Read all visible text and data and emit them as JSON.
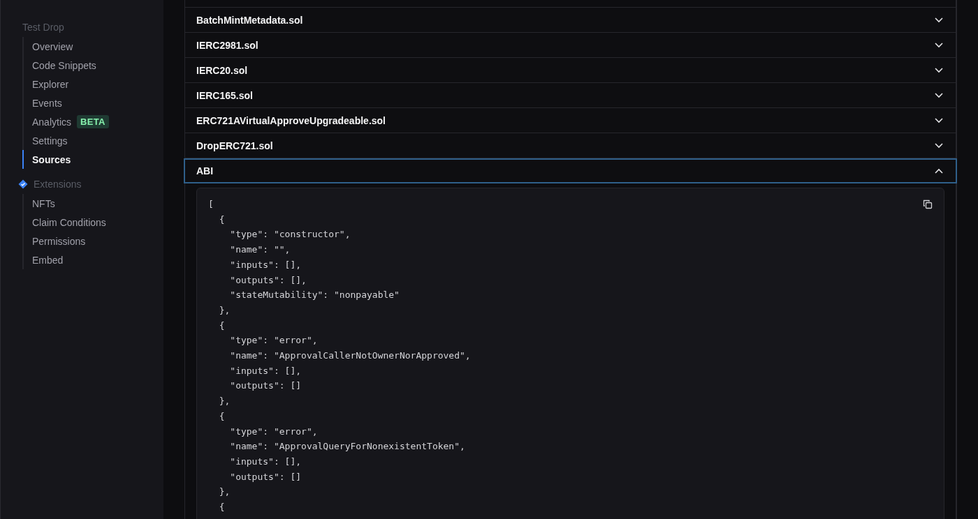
{
  "sidebar": {
    "title": "Test Drop",
    "items": [
      {
        "label": "Overview",
        "selected": false
      },
      {
        "label": "Code Snippets",
        "selected": false
      },
      {
        "label": "Explorer",
        "selected": false
      },
      {
        "label": "Events",
        "selected": false
      },
      {
        "label": "Analytics",
        "selected": false,
        "badge": "BETA"
      },
      {
        "label": "Settings",
        "selected": false
      },
      {
        "label": "Sources",
        "selected": true
      }
    ],
    "extensions": {
      "title": "Extensions",
      "items": [
        {
          "label": "NFTs",
          "selected": false
        },
        {
          "label": "Claim Conditions",
          "selected": false
        },
        {
          "label": "Permissions",
          "selected": false
        },
        {
          "label": "Embed",
          "selected": false
        }
      ]
    }
  },
  "sources": [
    {
      "name": "BatchMintMetadata.sol",
      "expanded": false
    },
    {
      "name": "IERC2981.sol",
      "expanded": false
    },
    {
      "name": "IERC20.sol",
      "expanded": false
    },
    {
      "name": "IERC165.sol",
      "expanded": false
    },
    {
      "name": "ERC721AVirtualApproveUpgradeable.sol",
      "expanded": false
    },
    {
      "name": "DropERC721.sol",
      "expanded": false
    },
    {
      "name": "ABI",
      "expanded": true,
      "code": [
        "[",
        "  {",
        "    \"type\": \"constructor\",",
        "    \"name\": \"\",",
        "    \"inputs\": [],",
        "    \"outputs\": [],",
        "    \"stateMutability\": \"nonpayable\"",
        "  },",
        "  {",
        "    \"type\": \"error\",",
        "    \"name\": \"ApprovalCallerNotOwnerNorApproved\",",
        "    \"inputs\": [],",
        "    \"outputs\": []",
        "  },",
        "  {",
        "    \"type\": \"error\",",
        "    \"name\": \"ApprovalQueryForNonexistentToken\",",
        "    \"inputs\": [],",
        "    \"outputs\": []",
        "  },",
        "  {"
      ]
    }
  ]
}
